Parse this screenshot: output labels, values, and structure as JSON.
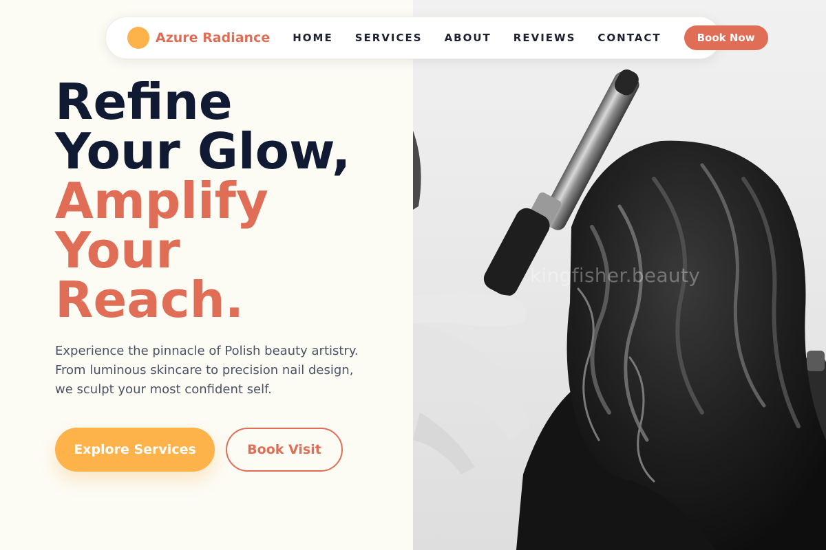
{
  "nav": {
    "brand": "Azure Radiance",
    "links": [
      "HOME",
      "SERVICES",
      "ABOUT",
      "REVIEWS",
      "CONTACT"
    ],
    "cta": "Book Now"
  },
  "hero": {
    "title_line1": "Refine",
    "title_line2": "Your Glow,",
    "title_line3": "Amplify",
    "title_line4": "Your",
    "title_line5": "Reach.",
    "description": "Experience the pinnacle of Polish beauty artistry. From luminous skincare to precision nail design, we sculpt your most confident self.",
    "primary_button": "Explore Services",
    "secondary_button": "Book Visit"
  },
  "photo": {
    "watermark": "kingfisher.beauty"
  },
  "colors": {
    "accent": "#e06d55",
    "secondary_accent": "#fdb24a",
    "heading_dark": "#111a33",
    "background": "#fcfbf4"
  },
  "icons": {
    "logo": "circle-logo-icon"
  }
}
